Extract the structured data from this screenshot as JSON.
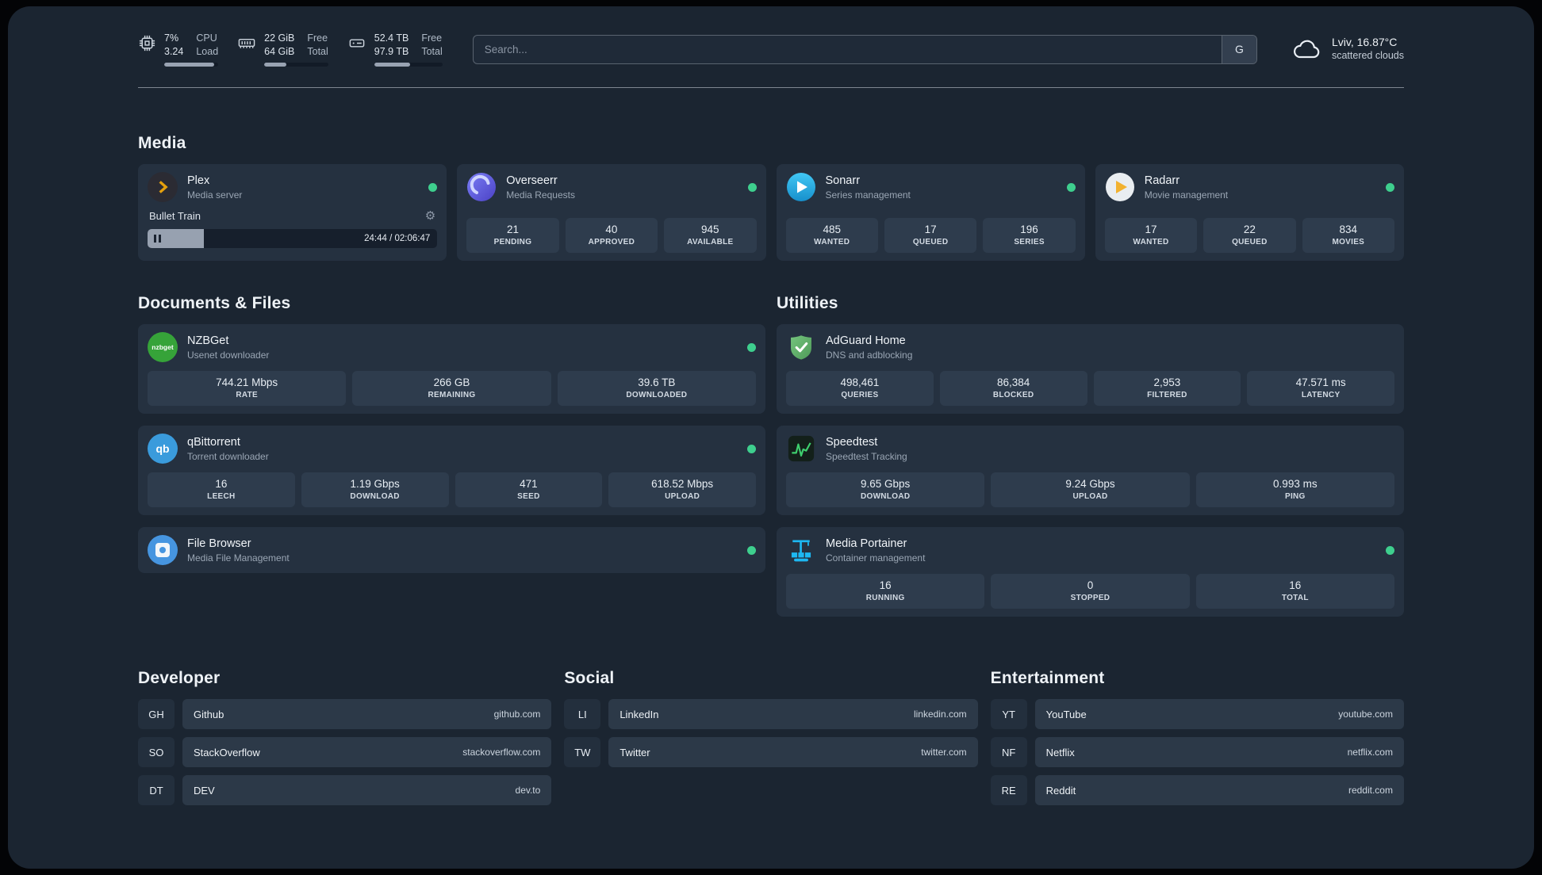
{
  "colors": {
    "status_green": "#3ecf8e"
  },
  "topbar": {
    "cpu": {
      "value1": "7%",
      "value2": "3.24",
      "label1": "CPU",
      "label2": "Load",
      "bar_percent": 93
    },
    "ram": {
      "value1": "22 GiB",
      "value2": "64 GiB",
      "label1": "Free",
      "label2": "Total",
      "bar_percent": 34
    },
    "disk": {
      "value1": "52.4 TB",
      "value2": "97.9 TB",
      "label1": "Free",
      "label2": "Total",
      "bar_percent": 53
    },
    "search": {
      "placeholder": "Search...",
      "button_label": "G"
    },
    "weather": {
      "location": "Lviv, 16.87°C",
      "condition": "scattered clouds"
    }
  },
  "sections": {
    "media": {
      "title": "Media",
      "plex": {
        "name": "Plex",
        "desc": "Media server",
        "now_playing": "Bullet Train",
        "time": "24:44 / 02:06:47",
        "progress_percent": 19.5
      },
      "overseerr": {
        "name": "Overseerr",
        "desc": "Media Requests",
        "stats": [
          {
            "value": "21",
            "label": "PENDING"
          },
          {
            "value": "40",
            "label": "APPROVED"
          },
          {
            "value": "945",
            "label": "AVAILABLE"
          }
        ]
      },
      "sonarr": {
        "name": "Sonarr",
        "desc": "Series management",
        "stats": [
          {
            "value": "485",
            "label": "WANTED"
          },
          {
            "value": "17",
            "label": "QUEUED"
          },
          {
            "value": "196",
            "label": "SERIES"
          }
        ]
      },
      "radarr": {
        "name": "Radarr",
        "desc": "Movie management",
        "stats": [
          {
            "value": "17",
            "label": "WANTED"
          },
          {
            "value": "22",
            "label": "QUEUED"
          },
          {
            "value": "834",
            "label": "MOVIES"
          }
        ]
      }
    },
    "documents": {
      "title": "Documents & Files",
      "nzbget": {
        "name": "NZBGet",
        "desc": "Usenet downloader",
        "icon_text": "nzbget",
        "stats": [
          {
            "value": "744.21 Mbps",
            "label": "RATE"
          },
          {
            "value": "266 GB",
            "label": "REMAINING"
          },
          {
            "value": "39.6 TB",
            "label": "DOWNLOADED"
          }
        ]
      },
      "qbittorrent": {
        "name": "qBittorrent",
        "desc": "Torrent downloader",
        "icon_text": "qb",
        "stats": [
          {
            "value": "16",
            "label": "LEECH"
          },
          {
            "value": "1.19 Gbps",
            "label": "DOWNLOAD"
          },
          {
            "value": "471",
            "label": "SEED"
          },
          {
            "value": "618.52 Mbps",
            "label": "UPLOAD"
          }
        ]
      },
      "filebrowser": {
        "name": "File Browser",
        "desc": "Media File Management"
      }
    },
    "utilities": {
      "title": "Utilities",
      "adguard": {
        "name": "AdGuard Home",
        "desc": "DNS and adblocking",
        "stats": [
          {
            "value": "498,461",
            "label": "QUERIES"
          },
          {
            "value": "86,384",
            "label": "BLOCKED"
          },
          {
            "value": "2,953",
            "label": "FILTERED"
          },
          {
            "value": "47.571 ms",
            "label": "LATENCY"
          }
        ]
      },
      "speedtest": {
        "name": "Speedtest",
        "desc": "Speedtest Tracking",
        "stats": [
          {
            "value": "9.65 Gbps",
            "label": "DOWNLOAD"
          },
          {
            "value": "9.24 Gbps",
            "label": "UPLOAD"
          },
          {
            "value": "0.993 ms",
            "label": "PING"
          }
        ]
      },
      "portainer": {
        "name": "Media Portainer",
        "desc": "Container management",
        "stats": [
          {
            "value": "16",
            "label": "RUNNING"
          },
          {
            "value": "0",
            "label": "STOPPED"
          },
          {
            "value": "16",
            "label": "TOTAL"
          }
        ]
      }
    },
    "bookmarks": {
      "developer": {
        "title": "Developer",
        "items": [
          {
            "abbr": "GH",
            "name": "Github",
            "url": "github.com"
          },
          {
            "abbr": "SO",
            "name": "StackOverflow",
            "url": "stackoverflow.com"
          },
          {
            "abbr": "DT",
            "name": "DEV",
            "url": "dev.to"
          }
        ]
      },
      "social": {
        "title": "Social",
        "items": [
          {
            "abbr": "LI",
            "name": "LinkedIn",
            "url": "linkedin.com"
          },
          {
            "abbr": "TW",
            "name": "Twitter",
            "url": "twitter.com"
          }
        ]
      },
      "entertainment": {
        "title": "Entertainment",
        "items": [
          {
            "abbr": "YT",
            "name": "YouTube",
            "url": "youtube.com"
          },
          {
            "abbr": "NF",
            "name": "Netflix",
            "url": "netflix.com"
          },
          {
            "abbr": "RE",
            "name": "Reddit",
            "url": "reddit.com"
          }
        ]
      }
    }
  }
}
